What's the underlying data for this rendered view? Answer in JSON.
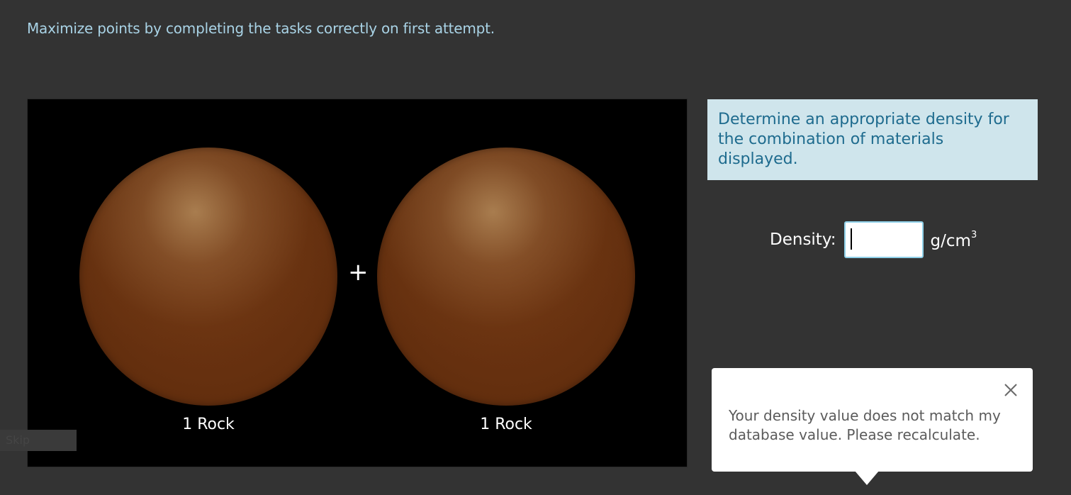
{
  "instruction": "Maximize points by completing the tasks correctly on first attempt.",
  "stage": {
    "left_label": "1 Rock",
    "operator": "+",
    "right_label": "1 Rock",
    "faint_text": "Skip"
  },
  "prompt": "Determine an appropriate density for the combination of materials displayed.",
  "density": {
    "label": "Density:",
    "value": "",
    "unit_base": "g/cm",
    "unit_exponent": "3"
  },
  "tooltip": {
    "message": "Your density value does not match my database value. Please recalculate.",
    "close_icon": "close-icon"
  },
  "colors": {
    "background": "#333333",
    "instruction_text": "#a9d3e6",
    "prompt_bg": "#cfe5ec",
    "prompt_text": "#1e6b8e",
    "rock": "#66300f"
  }
}
